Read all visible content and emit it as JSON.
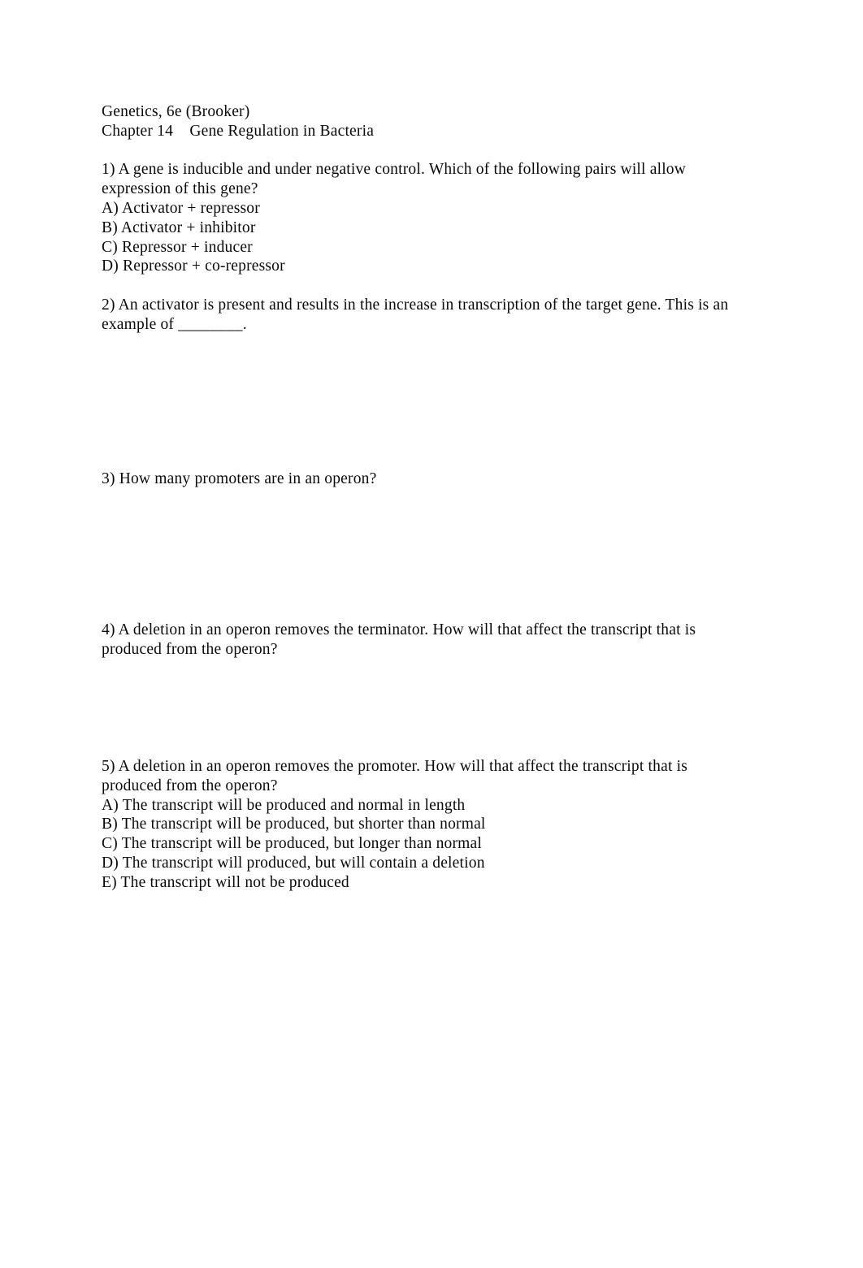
{
  "document": {
    "book_title": "Genetics, 6e (Brooker)",
    "chapter_line": "Chapter 14    Gene Regulation in Bacteria"
  },
  "questions": [
    {
      "number": "1)",
      "stem_line_1": "1) A gene is inducible and under negative control. Which of the following pairs will allow",
      "stem_line_2": "expression of this gene?",
      "options": [
        "A) Activator + repressor",
        "B) Activator + inhibitor",
        "C) Repressor + inducer",
        "D) Repressor + co-repressor"
      ]
    },
    {
      "number": "2)",
      "stem_line_1": "2) An activator is present and results in the increase in transcription of the target gene. This is an",
      "stem_line_2": "example of ________.",
      "options": []
    },
    {
      "number": "3)",
      "stem_line_1": "3) How many promoters are in an operon?",
      "options": []
    },
    {
      "number": "4)",
      "stem_line_1": "4) A deletion in an operon removes the terminator. How will that affect the transcript that is",
      "stem_line_2": "produced from the operon?",
      "options": []
    },
    {
      "number": "5)",
      "stem_line_1": "5) A deletion in an operon removes the promoter. How will that affect the transcript that is",
      "stem_line_2": "produced from the operon?",
      "options": [
        "A) The transcript will be produced and normal in length",
        "B) The transcript will be produced, but shorter than normal",
        "C) The transcript will be produced, but longer than normal",
        "D) The transcript will produced, but will contain a deletion",
        "E) The transcript will not be produced"
      ]
    }
  ],
  "obscured": {
    "note_line_1": "",
    "note_line_2": "",
    "note_line_3": "",
    "note_line_4": "",
    "note_line_5": ""
  }
}
